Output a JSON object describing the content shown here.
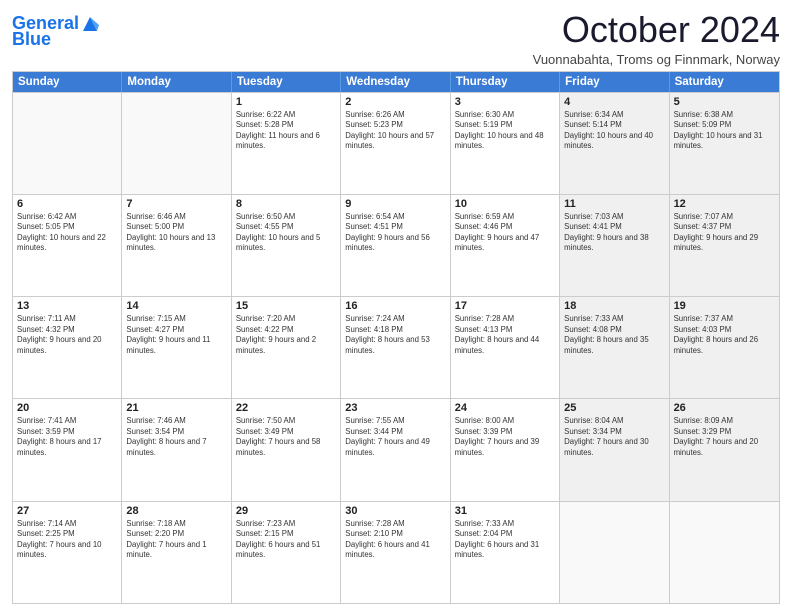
{
  "logo": {
    "line1": "General",
    "line2": "Blue"
  },
  "header": {
    "month": "October 2024",
    "subtitle": "Vuonnabahta, Troms og Finnmark, Norway"
  },
  "weekdays": [
    "Sunday",
    "Monday",
    "Tuesday",
    "Wednesday",
    "Thursday",
    "Friday",
    "Saturday"
  ],
  "weeks": [
    [
      {
        "day": "",
        "info": "",
        "empty": true
      },
      {
        "day": "",
        "info": "",
        "empty": true
      },
      {
        "day": "1",
        "info": "Sunrise: 6:22 AM\nSunset: 5:28 PM\nDaylight: 11 hours and 6 minutes."
      },
      {
        "day": "2",
        "info": "Sunrise: 6:26 AM\nSunset: 5:23 PM\nDaylight: 10 hours and 57 minutes."
      },
      {
        "day": "3",
        "info": "Sunrise: 6:30 AM\nSunset: 5:19 PM\nDaylight: 10 hours and 48 minutes."
      },
      {
        "day": "4",
        "info": "Sunrise: 6:34 AM\nSunset: 5:14 PM\nDaylight: 10 hours and 40 minutes."
      },
      {
        "day": "5",
        "info": "Sunrise: 6:38 AM\nSunset: 5:09 PM\nDaylight: 10 hours and 31 minutes."
      }
    ],
    [
      {
        "day": "6",
        "info": "Sunrise: 6:42 AM\nSunset: 5:05 PM\nDaylight: 10 hours and 22 minutes."
      },
      {
        "day": "7",
        "info": "Sunrise: 6:46 AM\nSunset: 5:00 PM\nDaylight: 10 hours and 13 minutes."
      },
      {
        "day": "8",
        "info": "Sunrise: 6:50 AM\nSunset: 4:55 PM\nDaylight: 10 hours and 5 minutes."
      },
      {
        "day": "9",
        "info": "Sunrise: 6:54 AM\nSunset: 4:51 PM\nDaylight: 9 hours and 56 minutes."
      },
      {
        "day": "10",
        "info": "Sunrise: 6:59 AM\nSunset: 4:46 PM\nDaylight: 9 hours and 47 minutes."
      },
      {
        "day": "11",
        "info": "Sunrise: 7:03 AM\nSunset: 4:41 PM\nDaylight: 9 hours and 38 minutes."
      },
      {
        "day": "12",
        "info": "Sunrise: 7:07 AM\nSunset: 4:37 PM\nDaylight: 9 hours and 29 minutes."
      }
    ],
    [
      {
        "day": "13",
        "info": "Sunrise: 7:11 AM\nSunset: 4:32 PM\nDaylight: 9 hours and 20 minutes."
      },
      {
        "day": "14",
        "info": "Sunrise: 7:15 AM\nSunset: 4:27 PM\nDaylight: 9 hours and 11 minutes."
      },
      {
        "day": "15",
        "info": "Sunrise: 7:20 AM\nSunset: 4:22 PM\nDaylight: 9 hours and 2 minutes."
      },
      {
        "day": "16",
        "info": "Sunrise: 7:24 AM\nSunset: 4:18 PM\nDaylight: 8 hours and 53 minutes."
      },
      {
        "day": "17",
        "info": "Sunrise: 7:28 AM\nSunset: 4:13 PM\nDaylight: 8 hours and 44 minutes."
      },
      {
        "day": "18",
        "info": "Sunrise: 7:33 AM\nSunset: 4:08 PM\nDaylight: 8 hours and 35 minutes."
      },
      {
        "day": "19",
        "info": "Sunrise: 7:37 AM\nSunset: 4:03 PM\nDaylight: 8 hours and 26 minutes."
      }
    ],
    [
      {
        "day": "20",
        "info": "Sunrise: 7:41 AM\nSunset: 3:59 PM\nDaylight: 8 hours and 17 minutes."
      },
      {
        "day": "21",
        "info": "Sunrise: 7:46 AM\nSunset: 3:54 PM\nDaylight: 8 hours and 7 minutes."
      },
      {
        "day": "22",
        "info": "Sunrise: 7:50 AM\nSunset: 3:49 PM\nDaylight: 7 hours and 58 minutes."
      },
      {
        "day": "23",
        "info": "Sunrise: 7:55 AM\nSunset: 3:44 PM\nDaylight: 7 hours and 49 minutes."
      },
      {
        "day": "24",
        "info": "Sunrise: 8:00 AM\nSunset: 3:39 PM\nDaylight: 7 hours and 39 minutes."
      },
      {
        "day": "25",
        "info": "Sunrise: 8:04 AM\nSunset: 3:34 PM\nDaylight: 7 hours and 30 minutes."
      },
      {
        "day": "26",
        "info": "Sunrise: 8:09 AM\nSunset: 3:29 PM\nDaylight: 7 hours and 20 minutes."
      }
    ],
    [
      {
        "day": "27",
        "info": "Sunrise: 7:14 AM\nSunset: 2:25 PM\nDaylight: 7 hours and 10 minutes."
      },
      {
        "day": "28",
        "info": "Sunrise: 7:18 AM\nSunset: 2:20 PM\nDaylight: 7 hours and 1 minute."
      },
      {
        "day": "29",
        "info": "Sunrise: 7:23 AM\nSunset: 2:15 PM\nDaylight: 6 hours and 51 minutes."
      },
      {
        "day": "30",
        "info": "Sunrise: 7:28 AM\nSunset: 2:10 PM\nDaylight: 6 hours and 41 minutes."
      },
      {
        "day": "31",
        "info": "Sunrise: 7:33 AM\nSunset: 2:04 PM\nDaylight: 6 hours and 31 minutes."
      },
      {
        "day": "",
        "info": "",
        "empty": true
      },
      {
        "day": "",
        "info": "",
        "empty": true
      }
    ]
  ]
}
